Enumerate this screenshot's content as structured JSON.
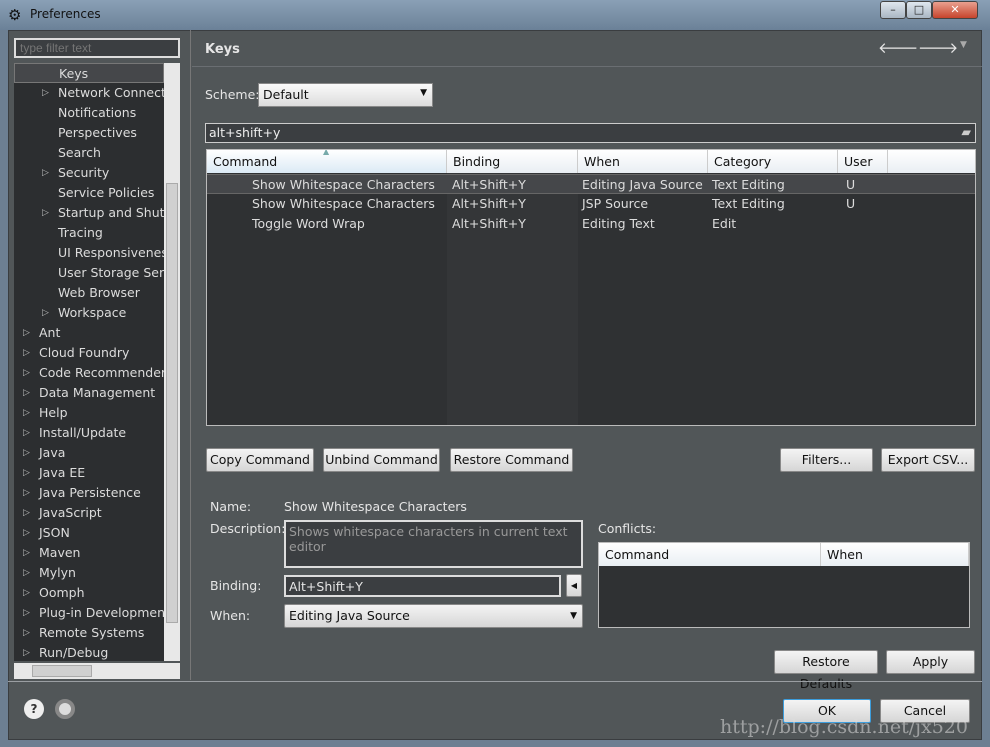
{
  "window": {
    "title": "Preferences",
    "min": "–",
    "max": "□",
    "close": "✕"
  },
  "sidebar": {
    "filter_placeholder": "type filter text",
    "items": [
      {
        "label": "Keys",
        "level": 1,
        "expandable": false,
        "selected": true
      },
      {
        "label": "Network Connections",
        "level": 1,
        "expandable": true
      },
      {
        "label": "Notifications",
        "level": 1,
        "expandable": false
      },
      {
        "label": "Perspectives",
        "level": 1,
        "expandable": false
      },
      {
        "label": "Search",
        "level": 1,
        "expandable": false
      },
      {
        "label": "Security",
        "level": 1,
        "expandable": true
      },
      {
        "label": "Service Policies",
        "level": 1,
        "expandable": false
      },
      {
        "label": "Startup and Shutdown",
        "level": 1,
        "expandable": true
      },
      {
        "label": "Tracing",
        "level": 1,
        "expandable": false
      },
      {
        "label": "UI Responsiveness",
        "level": 1,
        "expandable": false
      },
      {
        "label": "User Storage Service",
        "level": 1,
        "expandable": false
      },
      {
        "label": "Web Browser",
        "level": 1,
        "expandable": false
      },
      {
        "label": "Workspace",
        "level": 1,
        "expandable": true
      },
      {
        "label": "Ant",
        "level": 0,
        "expandable": true
      },
      {
        "label": "Cloud Foundry",
        "level": 0,
        "expandable": true
      },
      {
        "label": "Code Recommenders",
        "level": 0,
        "expandable": true
      },
      {
        "label": "Data Management",
        "level": 0,
        "expandable": true
      },
      {
        "label": "Help",
        "level": 0,
        "expandable": true
      },
      {
        "label": "Install/Update",
        "level": 0,
        "expandable": true
      },
      {
        "label": "Java",
        "level": 0,
        "expandable": true
      },
      {
        "label": "Java EE",
        "level": 0,
        "expandable": true
      },
      {
        "label": "Java Persistence",
        "level": 0,
        "expandable": true
      },
      {
        "label": "JavaScript",
        "level": 0,
        "expandable": true
      },
      {
        "label": "JSON",
        "level": 0,
        "expandable": true
      },
      {
        "label": "Maven",
        "level": 0,
        "expandable": true
      },
      {
        "label": "Mylyn",
        "level": 0,
        "expandable": true
      },
      {
        "label": "Oomph",
        "level": 0,
        "expandable": true
      },
      {
        "label": "Plug-in Development",
        "level": 0,
        "expandable": true
      },
      {
        "label": "Remote Systems",
        "level": 0,
        "expandable": true
      },
      {
        "label": "Run/Debug",
        "level": 0,
        "expandable": true
      }
    ]
  },
  "main": {
    "title": "Keys",
    "back_icon": "arrow-left-icon",
    "forward_icon": "arrow-right-icon",
    "scheme_label": "Scheme:",
    "scheme_value": "Default",
    "search_value": "alt+shift+y",
    "columns": [
      "Command",
      "Binding",
      "When",
      "Category",
      "User"
    ],
    "rows": [
      [
        "Show Whitespace Characters",
        "Alt+Shift+Y",
        "Editing Java Source",
        "Text Editing",
        "U"
      ],
      [
        "Show Whitespace Characters",
        "Alt+Shift+Y",
        "JSP Source",
        "Text Editing",
        "U"
      ],
      [
        "Toggle Word Wrap",
        "Alt+Shift+Y",
        "Editing Text",
        "Edit",
        ""
      ]
    ],
    "buttons": {
      "copy": "Copy Command",
      "unbind": "Unbind Command",
      "restore": "Restore Command",
      "filters": "Filters...",
      "export": "Export CSV..."
    },
    "details": {
      "name_label": "Name:",
      "name_value": "Show Whitespace Characters",
      "desc_label": "Description:",
      "desc_value": "Shows whitespace characters in current text editor",
      "binding_label": "Binding:",
      "binding_value": "Alt+Shift+Y",
      "when_label": "When:",
      "when_value": "Editing Java Source"
    },
    "conflicts": {
      "label": "Conflicts:",
      "columns": [
        "Command",
        "When"
      ]
    },
    "restore_defaults": "Restore Defaults",
    "apply": "Apply"
  },
  "footer": {
    "ok": "OK",
    "cancel": "Cancel",
    "watermark": "http://blog.csdn.net/jx520"
  }
}
